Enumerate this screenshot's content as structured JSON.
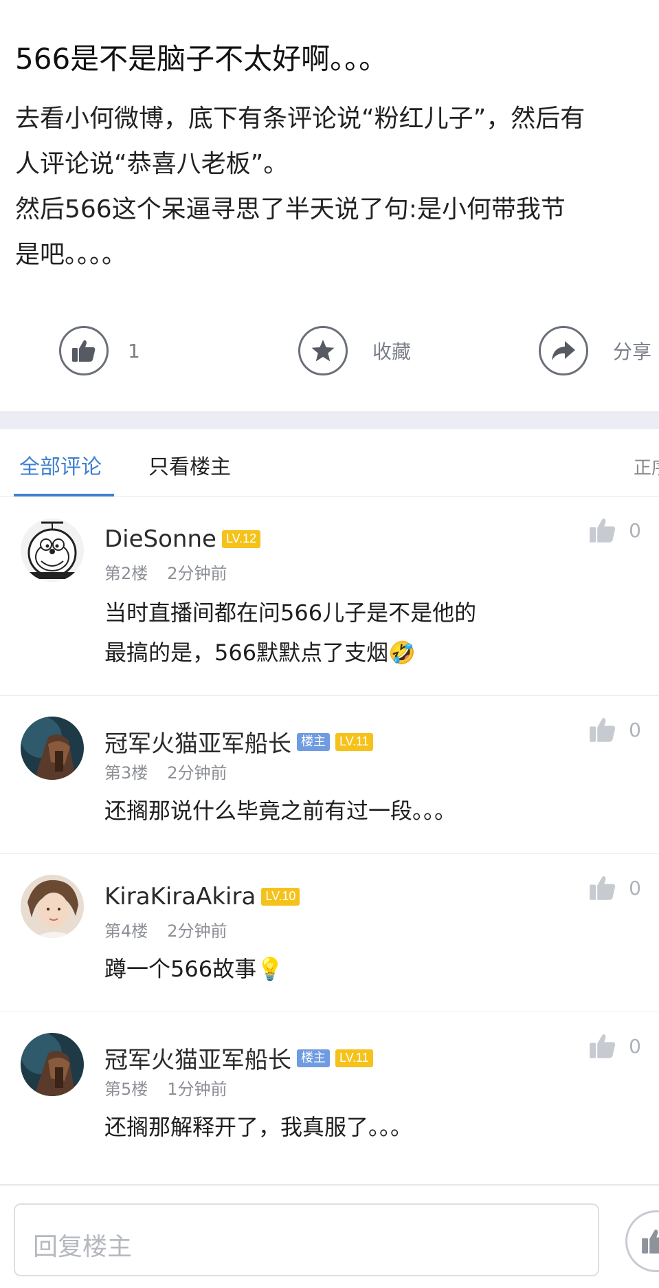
{
  "post": {
    "title": "566是不是脑子不太好啊。。。",
    "body_lines": [
      "去看小何微博，底下有条评论说“粉红儿子”，然后有",
      "人评论说“恭喜八老板”。",
      "然后566这个呆逼寻思了半天说了句:是小何带我节",
      "是吧。。。。"
    ],
    "actions": {
      "like_count": "1",
      "favorite_label": "收藏",
      "share_label": "分享"
    }
  },
  "tabs": {
    "all_comments": "全部评论",
    "op_only": "只看楼主",
    "sort": "正序"
  },
  "comments": [
    {
      "username": "DieSonne",
      "level": "LV.12",
      "is_op": false,
      "op_badge": "",
      "floor": "第2楼",
      "time": "2分钟前",
      "text_lines": [
        "当时直播间都在问566儿子是不是他的",
        "最搞的是，566默默点了支烟🤣"
      ],
      "likes": "0"
    },
    {
      "username": "冠军火猫亚军船长",
      "level": "LV.11",
      "is_op": true,
      "op_badge": "楼主",
      "floor": "第3楼",
      "time": "2分钟前",
      "text_lines": [
        "还搁那说什么毕竟之前有过一段。。。"
      ],
      "likes": "0"
    },
    {
      "username": "KiraKiraAkira",
      "level": "LV.10",
      "is_op": false,
      "op_badge": "",
      "floor": "第4楼",
      "time": "2分钟前",
      "text_lines": [
        "蹲一个566故事💡"
      ],
      "likes": "0"
    },
    {
      "username": "冠军火猫亚军船长",
      "level": "LV.11",
      "is_op": true,
      "op_badge": "楼主",
      "floor": "第5楼",
      "time": "1分钟前",
      "text_lines": [
        "还搁那解释开了，我真服了。。。"
      ],
      "likes": "0"
    }
  ],
  "reply": {
    "placeholder": "回复楼主"
  },
  "colors": {
    "accent": "#3d7fd1",
    "level_badge": "#f5c21b",
    "op_badge": "#6f9be0",
    "band": "#ececf4"
  },
  "icons": {
    "like": "thumbs-up-icon",
    "favorite": "star-icon",
    "share": "share-arrow-icon"
  }
}
